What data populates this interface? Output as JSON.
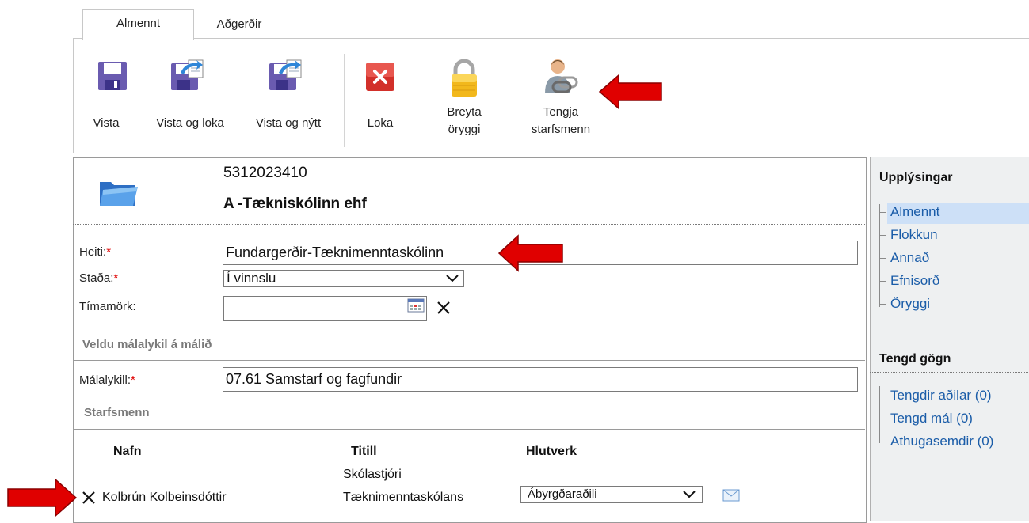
{
  "tabs": [
    {
      "label": "Almennt",
      "active": true
    },
    {
      "label": "Aðgerðir",
      "active": false
    }
  ],
  "ribbon": {
    "save": "Vista",
    "save_close": "Vista og loka",
    "save_new": "Vista og nýtt",
    "close": "Loka",
    "change_security_1": "Breyta",
    "change_security_2": "öryggi",
    "connect_staff_1": "Tengja",
    "connect_staff_2": "starfsmenn"
  },
  "record": {
    "number": "5312023410",
    "company": "A -Tækniskólinn ehf"
  },
  "form": {
    "name_label": "Heiti:",
    "name_value": "Fundargerðir-Tæknimenntaskólinn",
    "status_label": "Staða:",
    "status_value": "Í vinnslu",
    "deadline_label": "Tímamörk:",
    "deadline_value": "",
    "required_mark": "*",
    "section_key": "Veldu málalykil á málið",
    "key_label": "Málalykill:",
    "key_value": "07.61 Samstarf og fagfundir",
    "section_staff": "Starfsmenn"
  },
  "staff": {
    "col_name": "Nafn",
    "col_title": "Titill",
    "col_role": "Hlutverk",
    "rows": [
      {
        "name": "Kolbrún Kolbeinsdóttir",
        "title_1": "Skólastjóri",
        "title_2": "Tæknimenntaskólans",
        "role": "Ábyrgðaraðili"
      }
    ]
  },
  "side": {
    "info_header": "Upplýsingar",
    "info_items": [
      "Almennt",
      "Flokkun",
      "Annað",
      "Efnisorð",
      "Öryggi"
    ],
    "related_header": "Tengd gögn",
    "related_items": [
      "Tengdir aðilar (0)",
      "Tengd mál (0)",
      "Athugasemdir (0)"
    ]
  },
  "colors": {
    "link": "#1a5ca8",
    "required": "#e00000",
    "arrow": "#e00000",
    "side_bg": "#eef0f1",
    "selected_bg": "#cde0f7"
  }
}
